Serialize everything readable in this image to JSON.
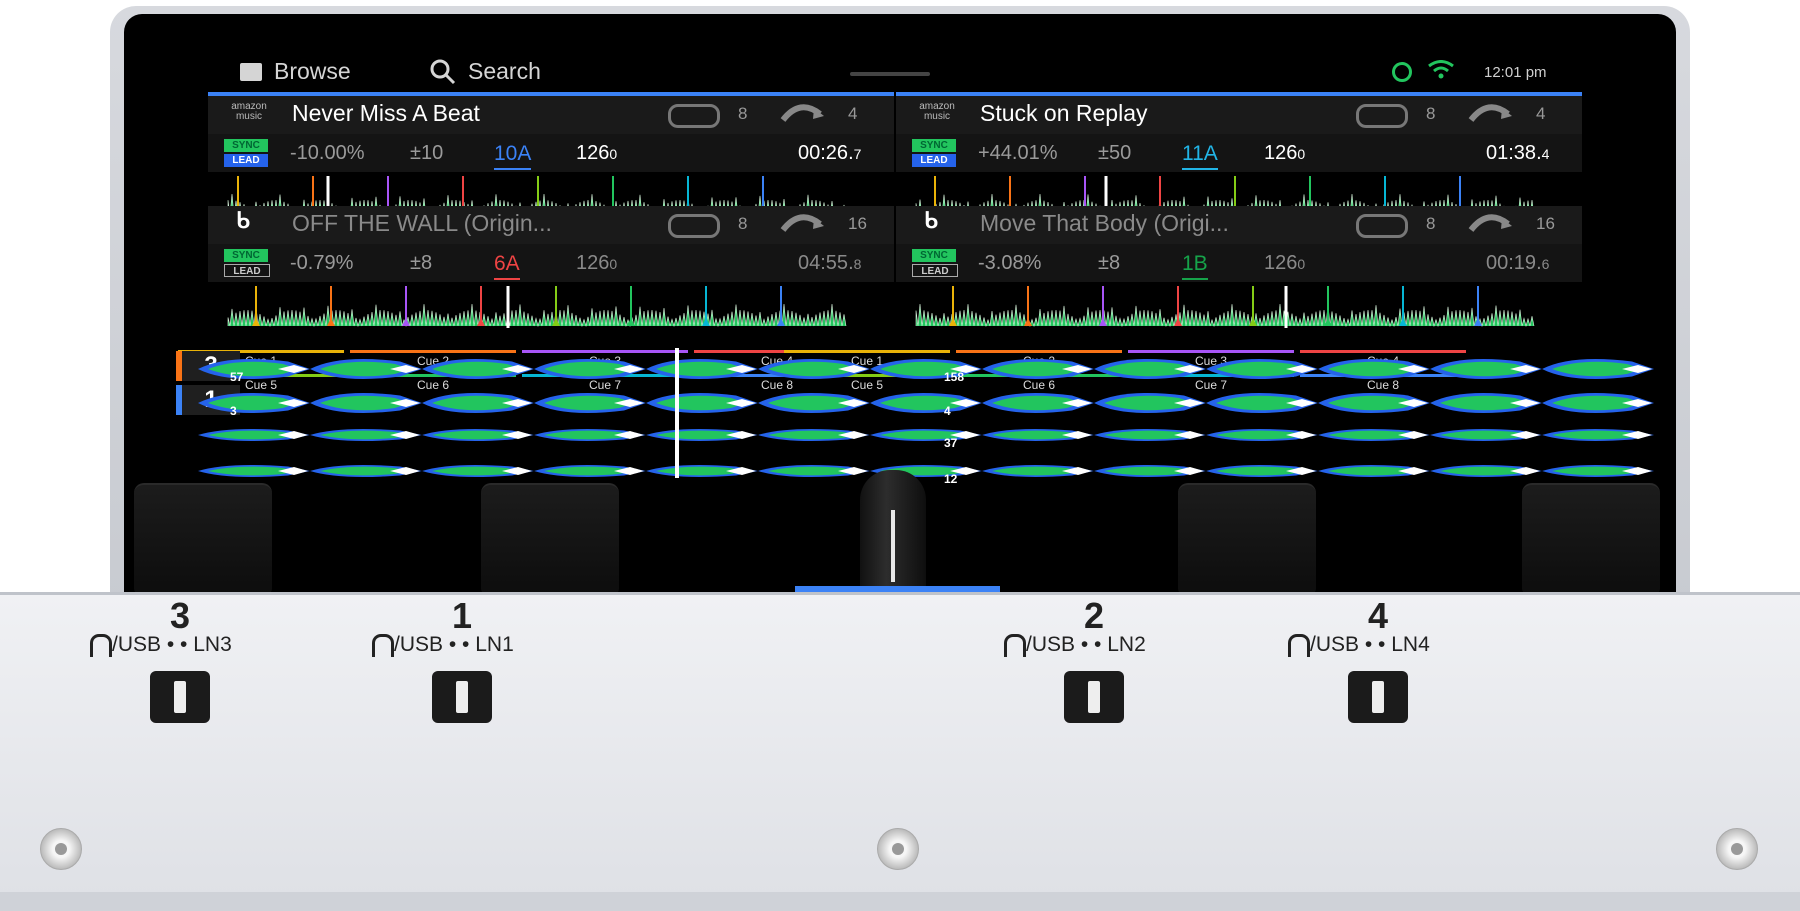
{
  "top_nav": {
    "browse": "Browse",
    "search": "Search",
    "time": "12:01 pm"
  },
  "decks": [
    {
      "id": "deck1",
      "title": "Never Miss A Beat",
      "service": "amazon music",
      "loop": "8",
      "jump": "4",
      "sync": "SYNC",
      "lead": "LEAD",
      "pitch": "-10.00%",
      "range": "±10",
      "key": "10A",
      "key_color": "#3b82f6",
      "bpm": "126",
      "bpm_dec": "0",
      "time": "00:26",
      "time_dec": "7"
    },
    {
      "id": "deck2",
      "title": "Stuck on Replay",
      "service": "amazon music",
      "loop": "8",
      "jump": "4",
      "sync": "SYNC",
      "lead": "LEAD",
      "pitch": "+44.01%",
      "range": "±50",
      "key": "11A",
      "key_color": "#22b5e6",
      "bpm": "126",
      "bpm_dec": "0",
      "time": "01:38",
      "time_dec": "4"
    },
    {
      "id": "deck3",
      "title": "OFF THE WALL (Origin...",
      "service": "beatport",
      "loop": "8",
      "jump": "16",
      "sync": "SYNC",
      "lead": "LEAD",
      "pitch": "-0.79%",
      "range": "±8",
      "key": "6A",
      "key_color": "#ef4444",
      "bpm": "126",
      "bpm_dec": "0",
      "time": "04:55",
      "time_dec": "8"
    },
    {
      "id": "deck4",
      "title": "Move That Body (Origi...",
      "service": "beatport",
      "loop": "8",
      "jump": "16",
      "sync": "SYNC",
      "lead": "LEAD",
      "pitch": "-3.08%",
      "range": "±8",
      "key": "1B",
      "key_color": "#16a34a",
      "bpm": "126",
      "bpm_dec": "0",
      "time": "00:19",
      "time_dec": "6"
    }
  ],
  "cue_pads_left": [
    "Cue 1",
    "Cue 2",
    "Cue 3",
    "Cue 4",
    "Cue 5",
    "Cue 6",
    "Cue 7",
    "Cue 8"
  ],
  "cue_pads_right": [
    "Cue 1",
    "Cue 2",
    "Cue 3",
    "Cue 4",
    "Cue 5",
    "Cue 6",
    "Cue 7",
    "Cue 8"
  ],
  "cue_colors": [
    "#eab308",
    "#f97316",
    "#a855f7",
    "#ef4444",
    "#84cc16",
    "#22c55e",
    "#06b6d4",
    "#3b82f6"
  ],
  "lanes": [
    {
      "deck": "3",
      "color": "#f97316",
      "marker_left": "57",
      "marker_mid": "158"
    },
    {
      "deck": "1",
      "color": "#3b82f6",
      "marker_left": "3",
      "marker_mid": "4"
    },
    {
      "deck": "",
      "color": "#555",
      "marker_left": "",
      "marker_mid": "37"
    },
    {
      "deck": "",
      "color": "#555",
      "marker_left": "",
      "marker_mid": "12"
    }
  ],
  "channels": [
    {
      "num": "3",
      "label": "/USB •   • LN3"
    },
    {
      "num": "1",
      "label": "/USB •   • LN1"
    },
    {
      "num": "2",
      "label": "/USB •   • LN2"
    },
    {
      "num": "4",
      "label": "/USB •   • LN4"
    }
  ],
  "colors": {
    "accent": "#3b82f6",
    "wave_green": "#22c55e",
    "wave_blue": "#2563eb"
  }
}
